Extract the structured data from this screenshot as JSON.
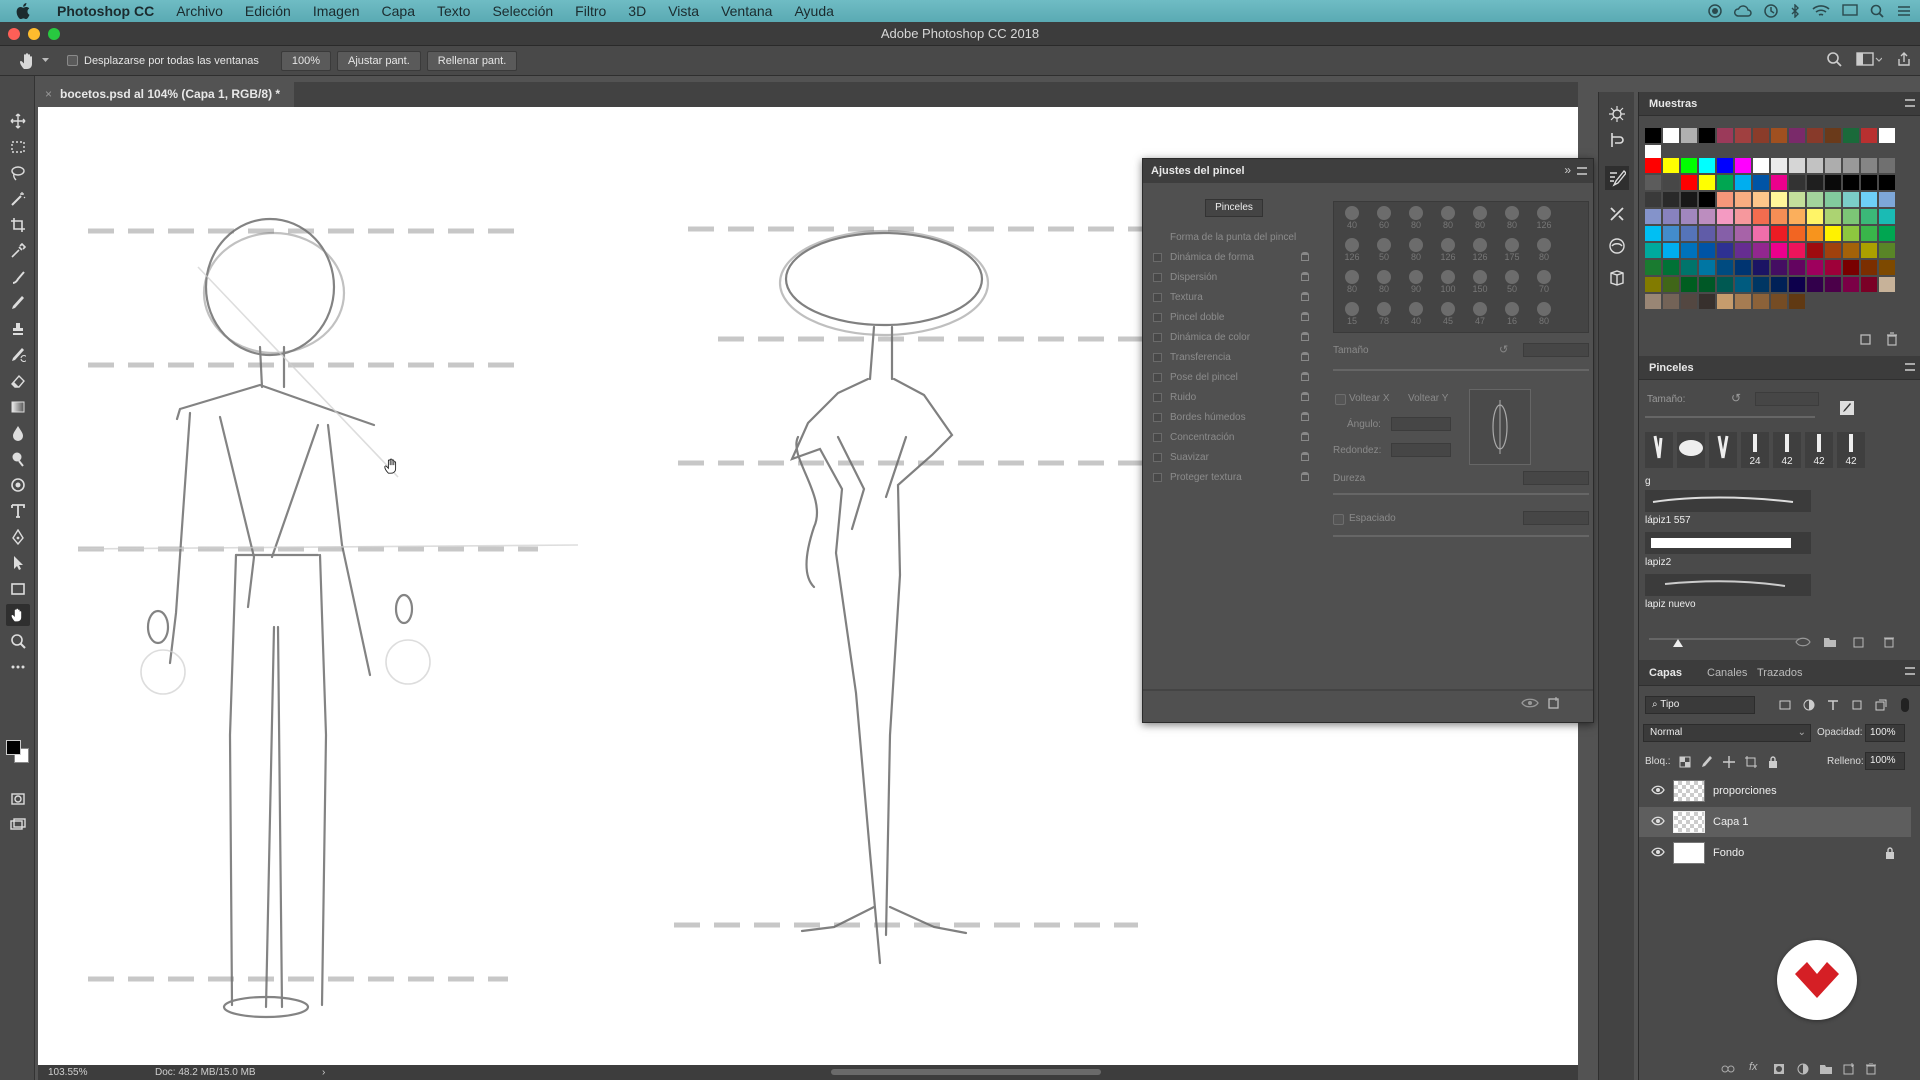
{
  "menubar": {
    "app_name": "Photoshop CC",
    "items": [
      "Archivo",
      "Edición",
      "Imagen",
      "Capa",
      "Texto",
      "Selección",
      "Filtro",
      "3D",
      "Vista",
      "Ventana",
      "Ayuda"
    ]
  },
  "window": {
    "title": "Adobe Photoshop CC 2018"
  },
  "options_bar": {
    "scroll_all_label": "Desplazarse por todas las ventanas",
    "zoom_value": "100%",
    "fit_screen_label": "Ajustar pant.",
    "fill_screen_label": "Rellenar pant."
  },
  "document": {
    "tab_title": "bocetos.psd al 104% (Capa 1, RGB/8) *"
  },
  "status_bar": {
    "zoom": "103.55%",
    "doc_info": "Doc: 48.2 MB/15.0 MB",
    "arrow": "›"
  },
  "brush_settings": {
    "title": "Ajustes del pincel",
    "brushes_button": "Pinceles",
    "options": [
      "Forma de la punta del pincel",
      "Dinámica de forma",
      "Dispersión",
      "Textura",
      "Pincel doble",
      "Dinámica de color",
      "Transferencia",
      "Pose del pincel",
      "Ruido",
      "Bordes húmedos",
      "Concentración",
      "Suavizar",
      "Proteger textura"
    ],
    "tip_sizes": [
      "40",
      "60",
      "80",
      "80",
      "80",
      "80",
      "126",
      "126",
      "50",
      "80",
      "126",
      "126",
      "175",
      "80",
      "80",
      "80",
      "90",
      "100",
      "150",
      "50",
      "70",
      "15",
      "78",
      "40",
      "45",
      "47",
      "16",
      "80"
    ],
    "size_label": "Tamaño",
    "flip_x_label": "Voltear X",
    "flip_y_label": "Voltear Y",
    "angle_label": "Ángulo:",
    "roundness_label": "Redondez:",
    "hardness_label": "Dureza",
    "spacing_label": "Espaciado"
  },
  "swatches": {
    "title": "Muestras",
    "recent": [
      "#000000",
      "#ffffff",
      "#b0b0b0",
      "#000000",
      "#9b3a5a",
      "#a04040",
      "#8a3c2a",
      "#a05020",
      "#7a2a6a",
      "#883a2a",
      "#6a3a1a",
      "#1a6a3a",
      "#b83030",
      "#ffffff",
      "#ffffff"
    ],
    "grid": [
      "#ff0000",
      "#ffff00",
      "#00ff00",
      "#00ffff",
      "#0000ff",
      "#ff00ff",
      "#ffffff",
      "#ebebeb",
      "#d6d6d6",
      "#c2c2c2",
      "#adadad",
      "#999999",
      "#858585",
      "#707070",
      "#5c5c5c",
      "#474747",
      "#ff0000",
      "#ffff00",
      "#00a651",
      "#00aeef",
      "#0054a6",
      "#ec008c",
      "#333333",
      "#1f1f1f",
      "#0a0a0a",
      "#000000",
      "#000000",
      "#000000",
      "#3a3a3a",
      "#2a2a2a",
      "#181818",
      "#000000",
      "#f7977a",
      "#f9ad81",
      "#fdc68a",
      "#fff79a",
      "#c4df9b",
      "#a3d39c",
      "#82ca9d",
      "#7bcdc8",
      "#6ecff6",
      "#7ea7d8",
      "#8493ca",
      "#8882be",
      "#a187be",
      "#bc8dbf",
      "#f49ac2",
      "#f6989d",
      "#f26c4f",
      "#f68e55",
      "#fbaf5c",
      "#fff467",
      "#acd372",
      "#7cc576",
      "#3bb878",
      "#1abbb4",
      "#00bff3",
      "#438ccb",
      "#5574b9",
      "#605ca8",
      "#855fa8",
      "#a763a8",
      "#f06eaa",
      "#ed1c24",
      "#f26522",
      "#f7941d",
      "#fff200",
      "#8dc73f",
      "#39b54a",
      "#00a651",
      "#00a99d",
      "#00aeef",
      "#0072bc",
      "#0054a6",
      "#2e3192",
      "#662d91",
      "#92278f",
      "#ec008c",
      "#ed145b",
      "#9e0b0f",
      "#a0410d",
      "#a36209",
      "#aba000",
      "#598527",
      "#1a7b30",
      "#007236",
      "#00746b",
      "#0076a3",
      "#004b80",
      "#003471",
      "#1b1464",
      "#440e62",
      "#630460",
      "#9e005d",
      "#9e0039",
      "#790000",
      "#7b2e00",
      "#7d4900",
      "#827b00",
      "#406618",
      "#005e20",
      "#005826",
      "#005952",
      "#005b7f",
      "#003663",
      "#002157",
      "#0d004c",
      "#32004b",
      "#4b0049",
      "#7b0046",
      "#7a0026",
      "#c7b299",
      "#998675",
      "#736357",
      "#534741",
      "#37302d",
      "#c69c6d",
      "#a67c52",
      "#8c6239",
      "#754c24",
      "#603913"
    ]
  },
  "brushes_panel": {
    "title": "Pinceles",
    "size_label": "Tamaño:",
    "tip_sizes": [
      "",
      "",
      "",
      "24",
      "42",
      "42",
      "42"
    ],
    "group_label": "g",
    "entries": [
      "lápiz1 557",
      "lapiz2",
      "lapiz nuevo"
    ]
  },
  "layers_panel": {
    "tabs": [
      "Capas",
      "Canales",
      "Trazados"
    ],
    "filter_label": "Tipo",
    "blend_mode": "Normal",
    "opacity_label": "Opacidad:",
    "opacity_value": "100%",
    "lock_label": "Bloq.:",
    "fill_label": "Relleno:",
    "fill_value": "100%",
    "layers": [
      {
        "name": "proporciones",
        "selected": false,
        "locked": false
      },
      {
        "name": "Capa 1",
        "selected": true,
        "locked": false
      },
      {
        "name": "Fondo",
        "selected": false,
        "locked": true
      }
    ]
  }
}
